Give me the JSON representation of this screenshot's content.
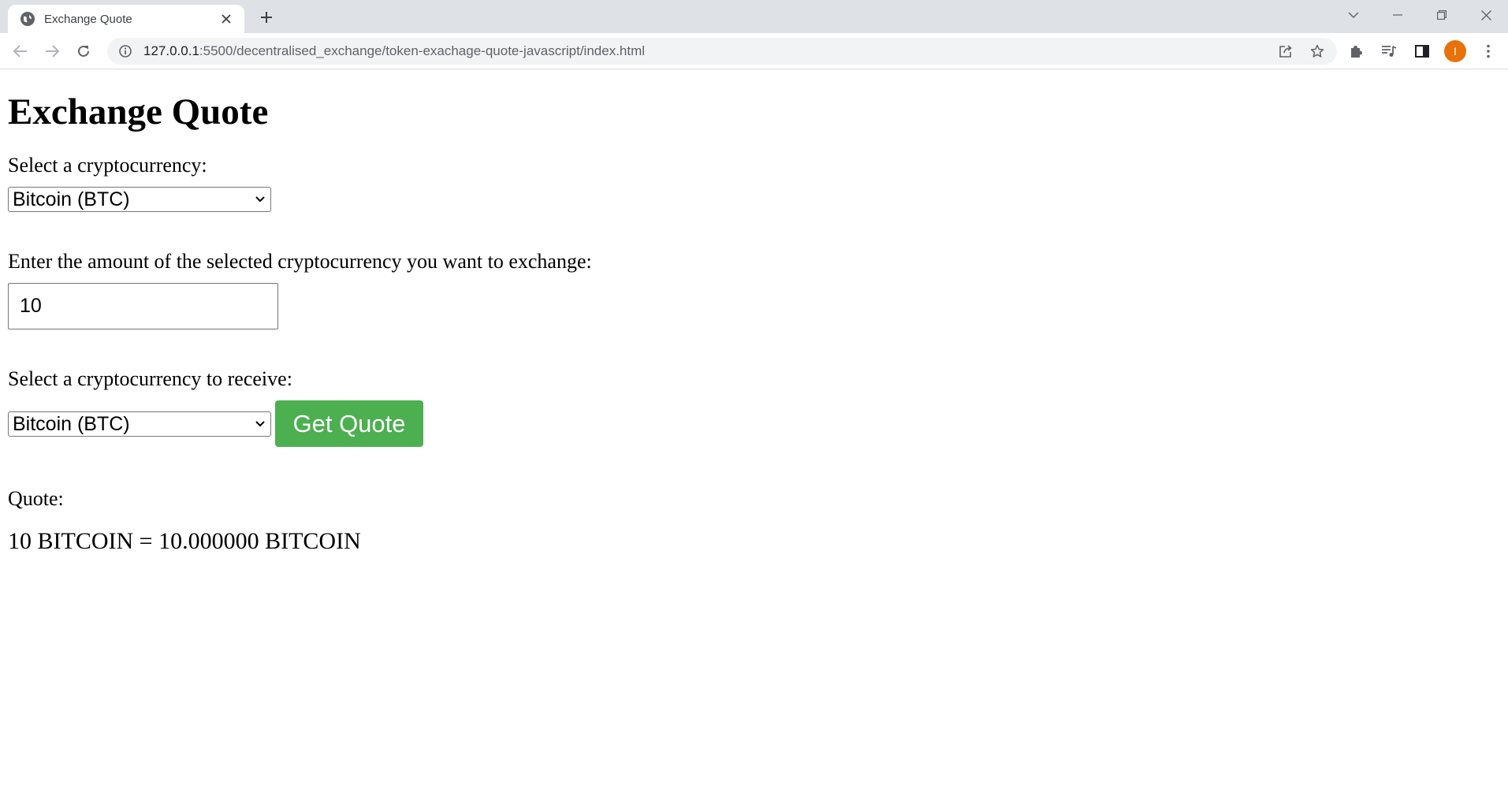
{
  "browser": {
    "tab_title": "Exchange Quote",
    "url_host": "127.0.0.1",
    "url_path": ":5500/decentralised_exchange/token-exachage-quote-javascript/index.html",
    "avatar_initial": "I",
    "avatar_color": "#e8710a"
  },
  "page": {
    "heading": "Exchange Quote",
    "from_label": "Select a cryptocurrency:",
    "from_selected": "Bitcoin (BTC)",
    "amount_label": "Enter the amount of the selected cryptocurrency you want to exchange:",
    "amount_value": "10",
    "to_label": "Select a cryptocurrency to receive:",
    "to_selected": "Bitcoin (BTC)",
    "quote_button": "Get Quote",
    "quote_button_color": "#4caf50",
    "quote_label": "Quote:",
    "quote_result": "10 BITCOIN = 10.000000 BITCOIN"
  },
  "icons": {
    "tab": [
      "globe-icon",
      "close-icon",
      "plus-icon"
    ],
    "window": [
      "chevron-down-icon",
      "minimize-icon",
      "restore-icon",
      "close-icon"
    ],
    "toolbar": [
      "back-arrow-icon",
      "forward-arrow-icon",
      "reload-icon",
      "info-icon",
      "share-icon",
      "star-icon",
      "puzzle-icon",
      "media-icon",
      "side-panel-icon",
      "more-icon"
    ]
  }
}
